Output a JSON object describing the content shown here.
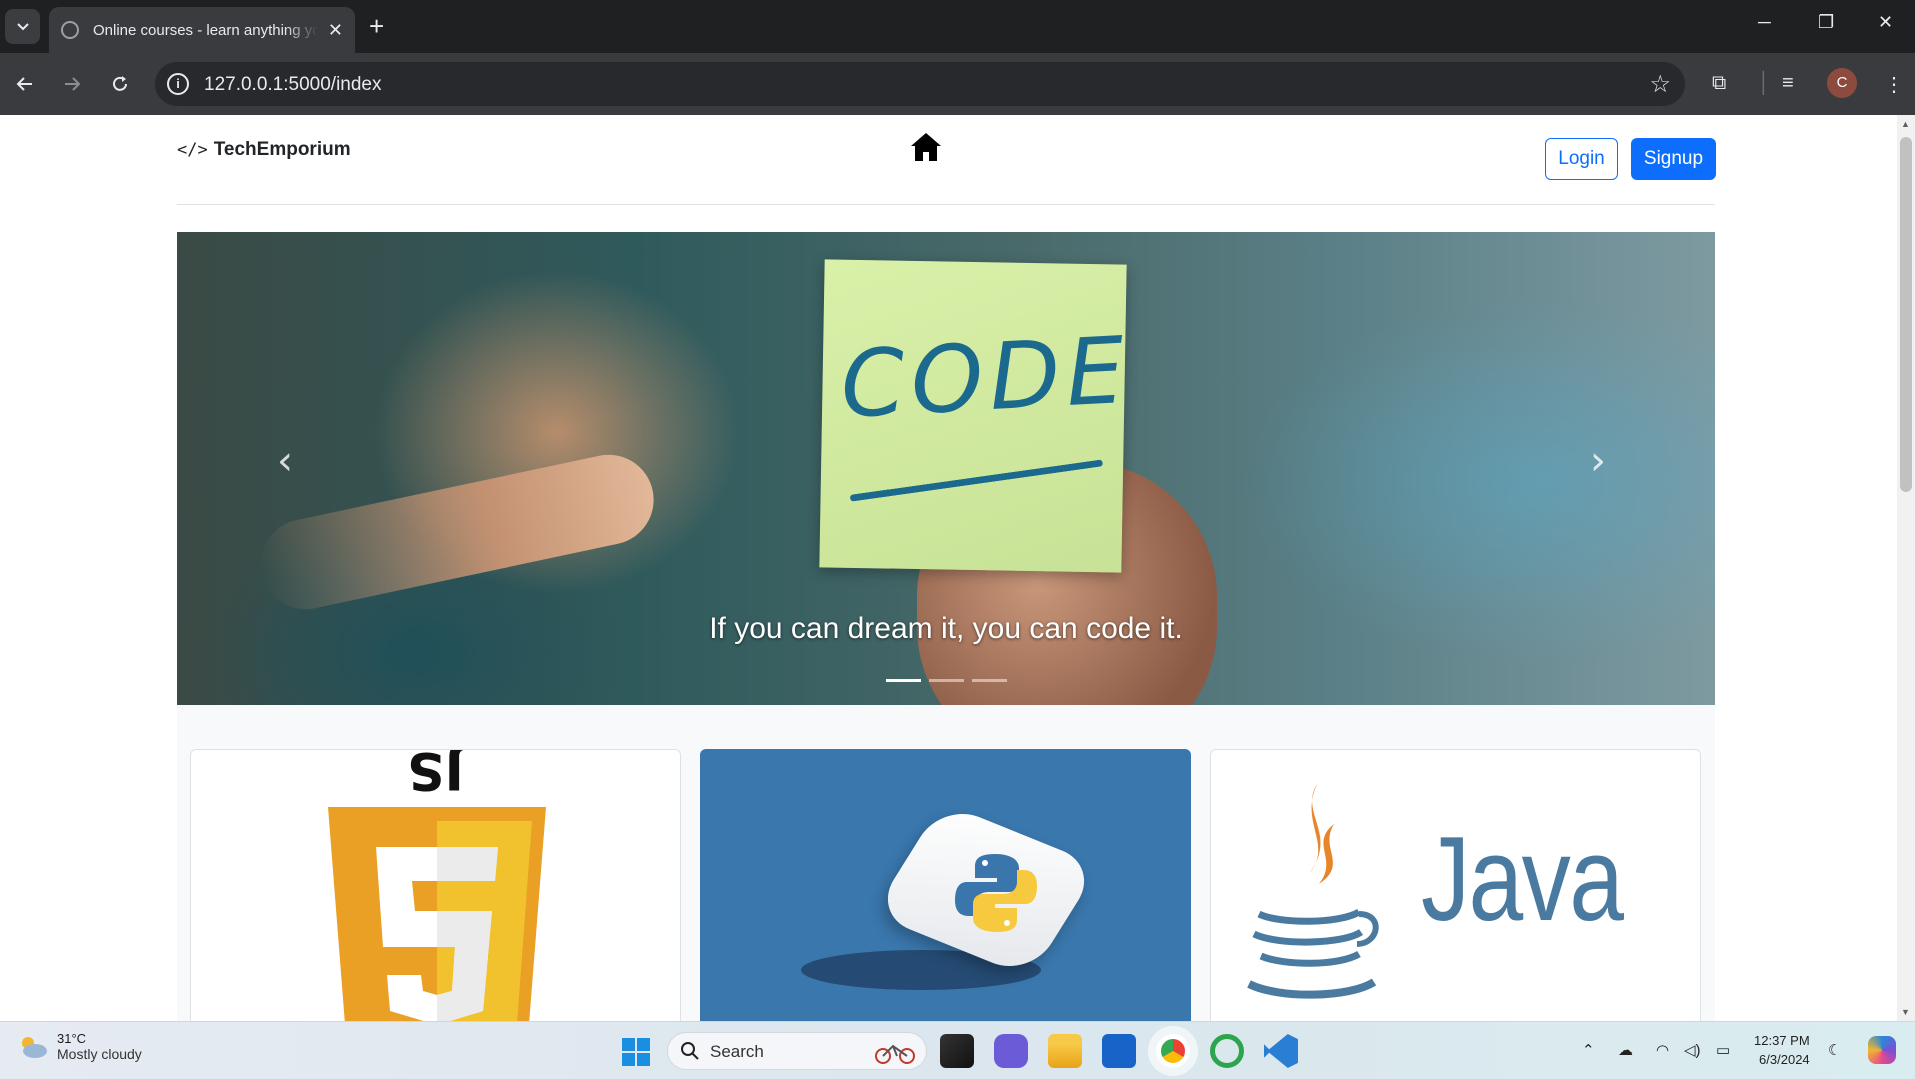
{
  "browser": {
    "tab_title": "Online courses - learn anything you want",
    "url": "127.0.0.1:5000/index",
    "profile_initial": "C"
  },
  "site": {
    "brand": "TechEmporium",
    "login_label": "Login",
    "signup_label": "Signup"
  },
  "carousel": {
    "note_text": "CODE",
    "caption": "If you can dream it, you can code it.",
    "slide_count": 3,
    "active_slide": 1
  },
  "courses": [
    {
      "name": "JavaScript",
      "logo_text": "JS"
    },
    {
      "name": "Python",
      "logo_text": ""
    },
    {
      "name": "Java",
      "logo_text": "Java"
    }
  ],
  "taskbar": {
    "temperature": "31°C",
    "weather": "Mostly cloudy",
    "search_label": "Search",
    "time": "12:37 PM",
    "date": "6/3/2024"
  },
  "colors": {
    "primary": "#0d6efd",
    "python_bg": "#3a77ad",
    "html5_orange": "#e9a024",
    "java_blue": "#4a7aa0",
    "java_orange": "#e7852b"
  }
}
